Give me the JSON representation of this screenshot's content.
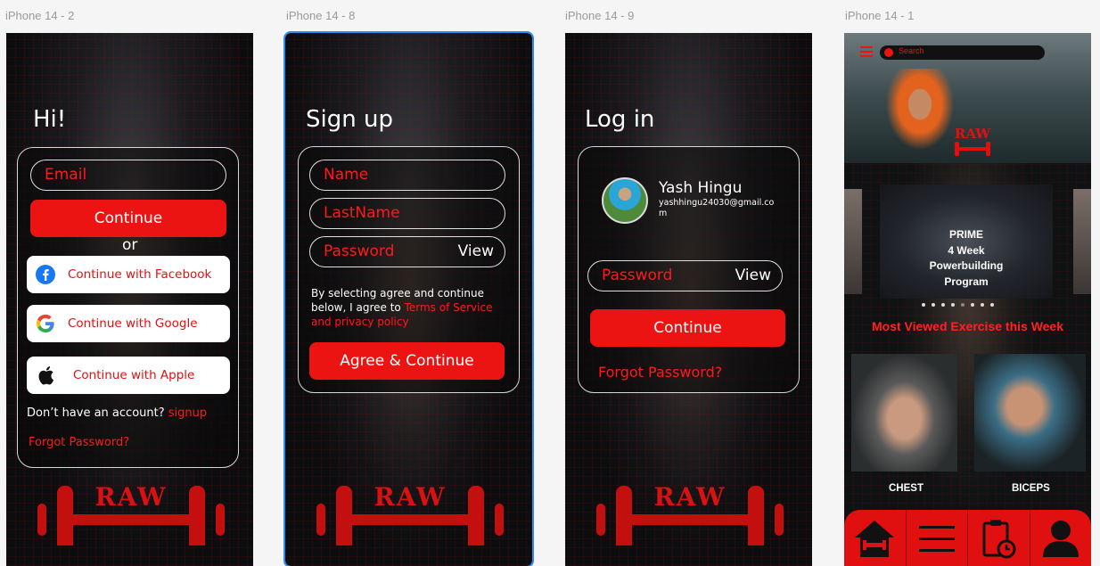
{
  "frames": [
    {
      "label": "iPhone 14 - 2"
    },
    {
      "label": "iPhone 14 - 8"
    },
    {
      "label": "iPhone 14 - 9"
    },
    {
      "label": "iPhone 14 - 1"
    }
  ],
  "welcome": {
    "heading": "Hi!",
    "email_placeholder": "Email",
    "continue": "Continue",
    "or": "or",
    "facebook": "Continue with Facebook",
    "google": "Continue with Google",
    "apple": "Continue with Apple",
    "no_account": "Don’t have an account?",
    "signup": "signup",
    "forgot": "Forgot Password?"
  },
  "signup": {
    "heading": "Sign up",
    "name_placeholder": "Name",
    "lastname_placeholder": "LastName",
    "password_placeholder": "Password",
    "view": "View",
    "terms_prefix": "By selecting agree and continue below, I agree to",
    "terms_link": "Terms of Service and privacy policy",
    "agree_button": "Agree & Continue"
  },
  "login": {
    "heading": "Log in",
    "user_name": "Yash Hingu",
    "user_email": "yashhingu24030@gmail.com",
    "password_placeholder": "Password",
    "view": "View",
    "continue": "Continue",
    "forgot": "Forgot Password?"
  },
  "brand": {
    "logo_text": "RAW",
    "accent": "#ec1313"
  },
  "home": {
    "search_label": "Search",
    "promo": [
      "PRIME",
      "4 Week",
      "Powerbuilding",
      "Program"
    ],
    "carousel_dots": 8,
    "carousel_active_dot": 4,
    "section_title": "Most Viewed Exercise this Week",
    "exercises": [
      "CHEST",
      "BICEPS"
    ],
    "nav_icons": [
      "home-icon",
      "menu-icon",
      "workout-log-icon",
      "profile-icon"
    ]
  }
}
